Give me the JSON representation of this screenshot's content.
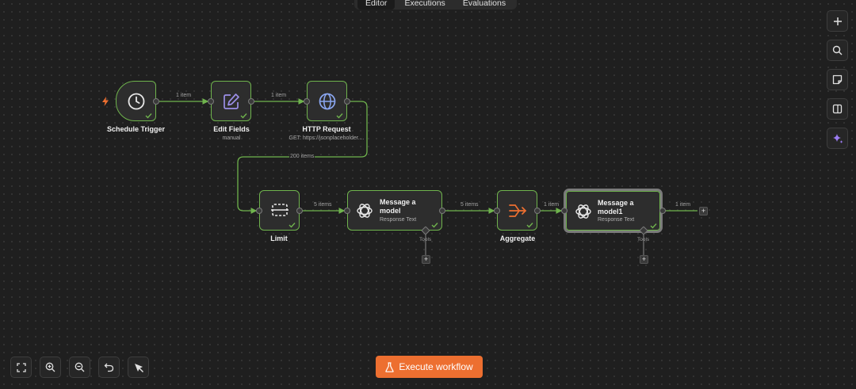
{
  "tabs": [
    {
      "label": "Editor",
      "active": true
    },
    {
      "label": "Executions"
    },
    {
      "label": "Evaluations"
    }
  ],
  "right_toolbar": [
    "plus-icon",
    "search-icon",
    "sticky-note-icon",
    "panel-toggle-icon",
    "ai-sparkle-icon"
  ],
  "nodes": {
    "schedule": {
      "label": "Schedule Trigger"
    },
    "edit": {
      "label": "Edit Fields",
      "sub": "manual"
    },
    "http": {
      "label": "HTTP Request",
      "sub": "GET: https://jsonplaceholder...."
    },
    "limit": {
      "label": "Limit"
    },
    "msg1": {
      "label": "Message a model",
      "sub": "Response Text"
    },
    "aggregate": {
      "label": "Aggregate"
    },
    "msg2": {
      "label": "Message a model1",
      "sub": "Response Text"
    }
  },
  "connections": {
    "c1": "1 item",
    "c2": "1 item",
    "c3": "200 items",
    "c4": "5 items",
    "c5": "5 items",
    "c6": "1 item",
    "c7": "1 item"
  },
  "tools_label": "Tools",
  "bottom_toolbar": [
    "fit-view-icon",
    "zoom-in-icon",
    "zoom-out-icon",
    "undo-icon",
    "tidy-up-icon"
  ],
  "execute_button": {
    "label": "Execute workflow"
  },
  "colors": {
    "success": "#6fb34d",
    "accent": "#ed6f30",
    "canvas": "#1f1f1f"
  }
}
